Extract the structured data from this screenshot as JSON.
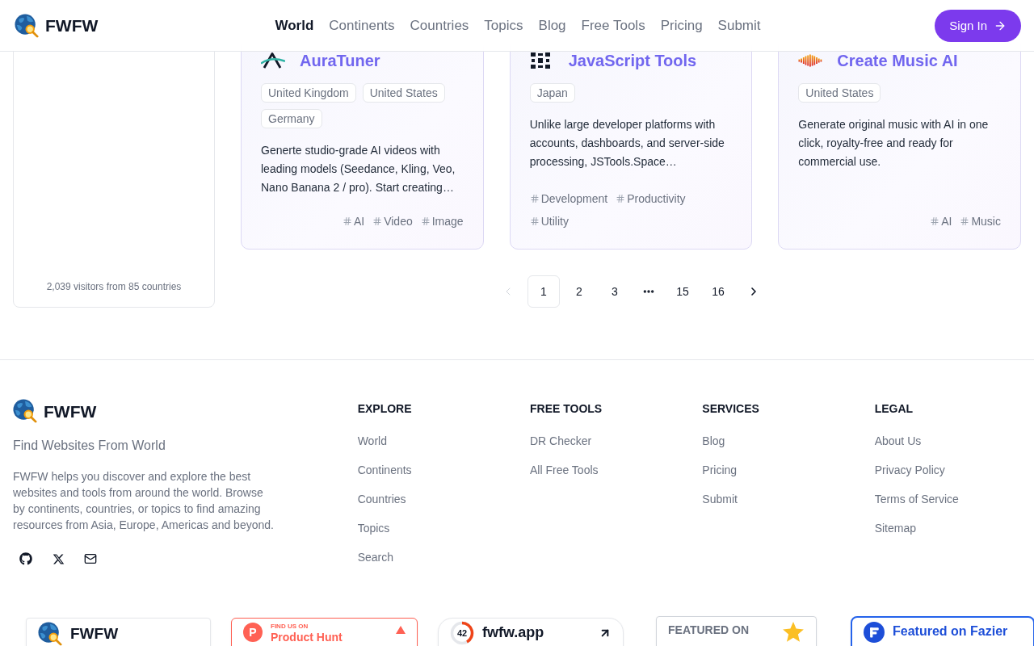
{
  "header": {
    "brand": "FWFW",
    "nav": [
      {
        "label": "World",
        "selected": true
      },
      {
        "label": "Continents",
        "selected": false
      },
      {
        "label": "Countries",
        "selected": false
      },
      {
        "label": "Topics",
        "selected": false
      },
      {
        "label": "Blog",
        "selected": false
      },
      {
        "label": "Free Tools",
        "selected": false
      },
      {
        "label": "Pricing",
        "selected": false
      },
      {
        "label": "Submit",
        "selected": false
      }
    ],
    "sign_in": "Sign In"
  },
  "sidebar": {
    "visitors": "2,039 visitors from 85 countries"
  },
  "cards": [
    {
      "title": "AuraTuner",
      "countries": [
        "United Kingdom",
        "United States",
        "Germany"
      ],
      "description": "Generte studio-grade AI videos with leading models (Seedance, Kling, Veo, Nano Banana 2 / pro). Start creating…",
      "topics": [
        "AI",
        "Video",
        "Image"
      ]
    },
    {
      "title": "JavaScript Tools",
      "countries": [
        "Japan"
      ],
      "description": "Unlike large developer platforms with accounts, dashboards, and server-side processing, JSTools.Space…",
      "topics": [
        "Development",
        "Productivity",
        "Utility"
      ]
    },
    {
      "title": "Create Music AI",
      "countries": [
        "United States"
      ],
      "description": "Generate original music with AI in one click, royalty-free and ready for commercial use.",
      "topics": [
        "AI",
        "Music"
      ]
    }
  ],
  "pagination": {
    "items": [
      {
        "kind": "prev",
        "disabled": true
      },
      {
        "kind": "page",
        "label": "1",
        "selected": true
      },
      {
        "kind": "page",
        "label": "2",
        "selected": false
      },
      {
        "kind": "page",
        "label": "3",
        "selected": false
      },
      {
        "kind": "ellipsis"
      },
      {
        "kind": "page",
        "label": "15",
        "selected": false
      },
      {
        "kind": "page",
        "label": "16",
        "selected": false
      },
      {
        "kind": "next",
        "disabled": false
      }
    ]
  },
  "footer": {
    "brand": "FWFW",
    "tagline": "Find Websites From World",
    "description": "FWFW helps you discover and explore the best websites and tools from around the world. Browse by continents, countries, or topics to find amazing resources from Asia, Europe, Americas and beyond.",
    "columns": [
      {
        "heading": "EXPLORE",
        "links": [
          "World",
          "Continents",
          "Countries",
          "Topics",
          "Search"
        ]
      },
      {
        "heading": "FREE TOOLS",
        "links": [
          "DR Checker",
          "All Free Tools"
        ]
      },
      {
        "heading": "SERVICES",
        "links": [
          "Blog",
          "Pricing",
          "Submit"
        ]
      },
      {
        "heading": "LEGAL",
        "links": [
          "About Us",
          "Privacy Policy",
          "Terms of Service",
          "Sitemap"
        ]
      }
    ]
  },
  "badges": [
    {
      "kind": "brand",
      "text": "FWFW"
    },
    {
      "kind": "find_us",
      "mark": "P",
      "eyebrow": "FIND US ON",
      "name": "Product Hunt"
    },
    {
      "kind": "rating",
      "score": "42",
      "level": 0.42,
      "domain": "fwfw.app"
    },
    {
      "kind": "featured_on",
      "text": "FEATURED ON"
    },
    {
      "kind": "featured_blue",
      "text": "Featured on Fazier"
    }
  ]
}
